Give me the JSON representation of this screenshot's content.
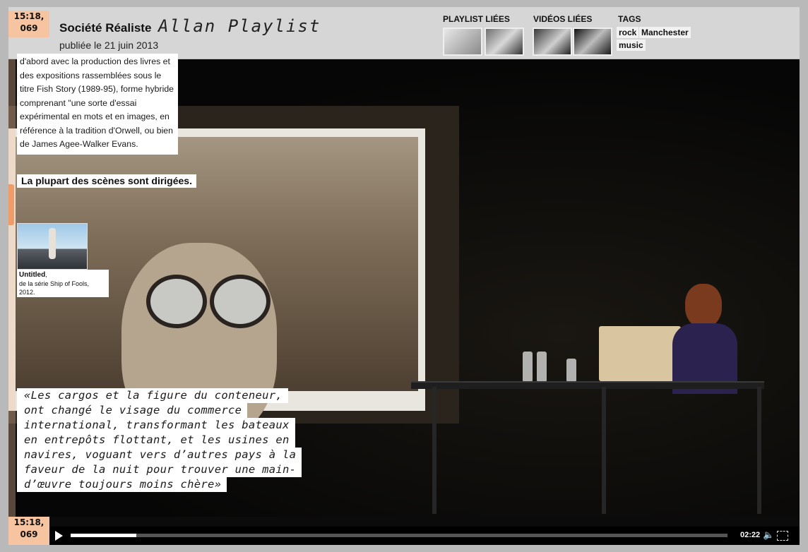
{
  "header": {
    "timestamp_top": "15:18,\n069",
    "site_title": "Société Réaliste",
    "playlist_title": "Allan Playlist",
    "published": "publiée le 21 juin 2013",
    "related_playlists_label": "PLAYLIST LIÉES",
    "related_videos_label": "VIDÉOS LIÉES",
    "tags_label": "TAGS",
    "tags": [
      "rock",
      "Manchester",
      "music"
    ]
  },
  "content": {
    "paragraph": "d'abord avec la production des livres et des expositions rassemblées sous le titre Fish Story (1989-95), forme hybride comprenant \"une sorte d'essai expérimental en mots et en images, en référence à la tradition d'Orwell, ou bien de James Agee-Walker Evans.",
    "callout": "La plupart des scènes sont dirigées.",
    "caption_title": "Untitled",
    "caption_text": "de la série Ship of Fools, 2012.",
    "quote_lines": [
      "«Les cargos et la figure du conteneur,",
      "ont changé le visage du commerce",
      "international, transformant les bateaux",
      "en entrepôts flottant, et les usines en",
      "navires, voguant vers d’autres pays à la",
      "faveur de la nuit pour trouver une main-",
      "d’œuvre toujours moins chère»"
    ]
  },
  "player": {
    "timestamp_bottom": "15:18,\n069",
    "time": "02:22",
    "progress": 0.1
  },
  "icons": {
    "play": "play-icon",
    "volume": "volume-icon",
    "fullscreen": "fullscreen-icon"
  }
}
